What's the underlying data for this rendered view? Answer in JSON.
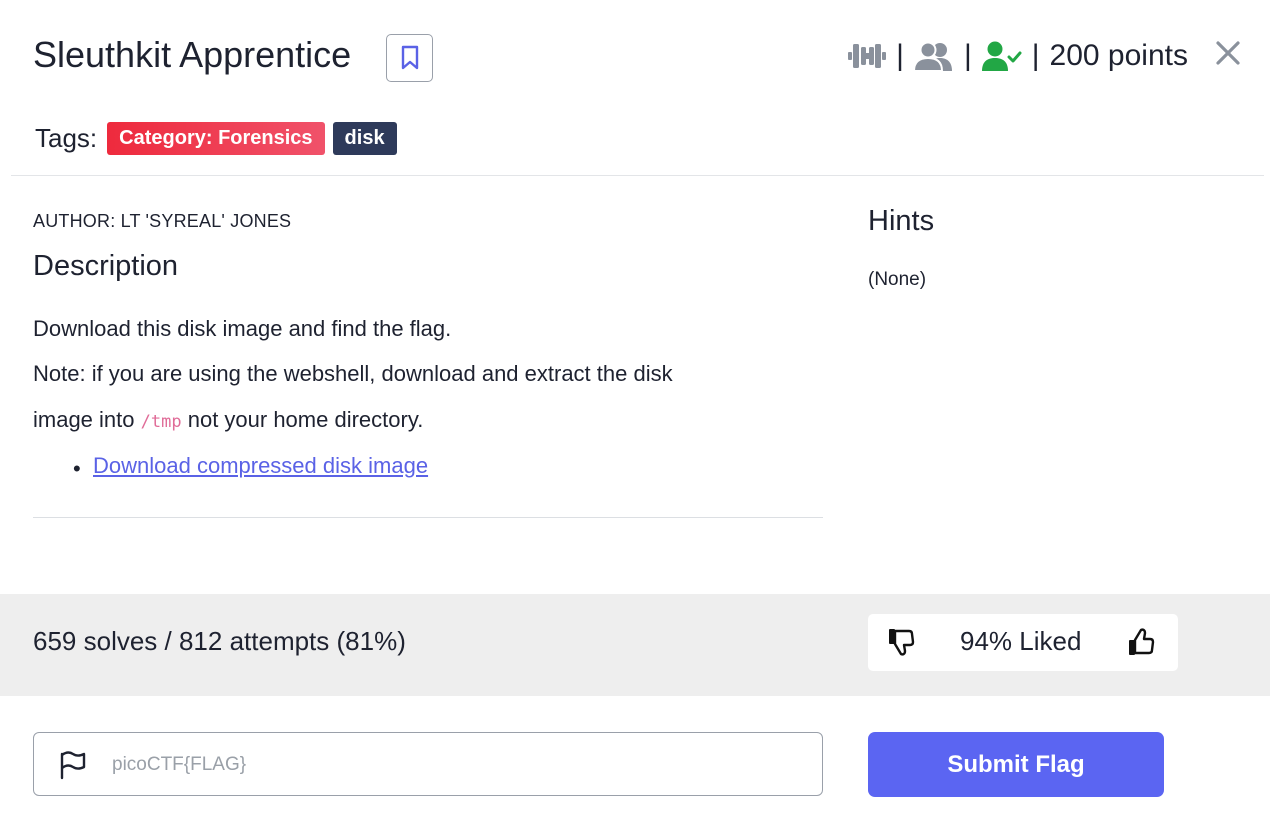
{
  "challenge": {
    "title": "Sleuthkit Apprentice",
    "points": "200 points",
    "separator": "|"
  },
  "tags": {
    "label": "Tags:",
    "items": [
      "Category: Forensics",
      "disk"
    ]
  },
  "description": {
    "author": "AUTHOR: LT 'SYREAL' JONES",
    "heading": "Description",
    "line1": "Download this disk image and find the flag.",
    "line2": "Note: if you are using the webshell, download and extract the disk",
    "line3_pre": "image into",
    "line3_code": "/tmp",
    "line3_post": "not your home directory.",
    "link": "Download compressed disk image"
  },
  "hints": {
    "heading": "Hints",
    "value": "(None)"
  },
  "stats": {
    "solves": "659 solves / 812 attempts (81%)",
    "liked": "94% Liked"
  },
  "submit": {
    "placeholder": "picoCTF{FLAG}",
    "button": "Submit Flag"
  },
  "colors": {
    "accent": "#5b65f2",
    "tag_category": "#ee2a3d",
    "tag_disk": "#2e3a5a",
    "solved_green": "#22a745",
    "icon_gray": "#8a919c"
  },
  "icons": [
    "bookmark-icon",
    "dumbbell-icon",
    "users-icon",
    "user-check-icon",
    "close-icon",
    "thumbs-down-icon",
    "thumbs-up-icon",
    "flag-icon"
  ]
}
